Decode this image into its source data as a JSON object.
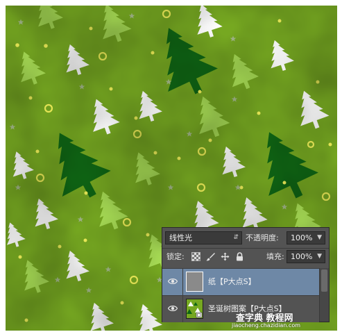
{
  "layers_panel": {
    "blend_mode": "线性光",
    "opacity_label": "不透明度:",
    "opacity_value": "100%",
    "lock_label": "锁定:",
    "fill_label": "填充:",
    "fill_value": "100%",
    "layers": [
      {
        "name": "纸【P大点S】",
        "selected": true,
        "visible": true
      },
      {
        "name": "圣诞树图案【P大点S】",
        "selected": false,
        "visible": true
      }
    ]
  },
  "watermark": {
    "title": "查字典 教程网",
    "url": "jiaocheng.chazidian.com"
  },
  "colors": {
    "background_green": "#76a821",
    "dark_tree": "#0f6614",
    "light_tree": "#a8dd55",
    "white_tree": "#ffffff",
    "dot_yellow": "#f2f25a",
    "star_gray": "#a4b98a",
    "selected_layer": "#6e88a6"
  },
  "icons": [
    "eye-icon",
    "lock-transparent-icon",
    "lock-brush-icon",
    "lock-move-icon",
    "lock-all-icon",
    "select-caret-icon"
  ]
}
